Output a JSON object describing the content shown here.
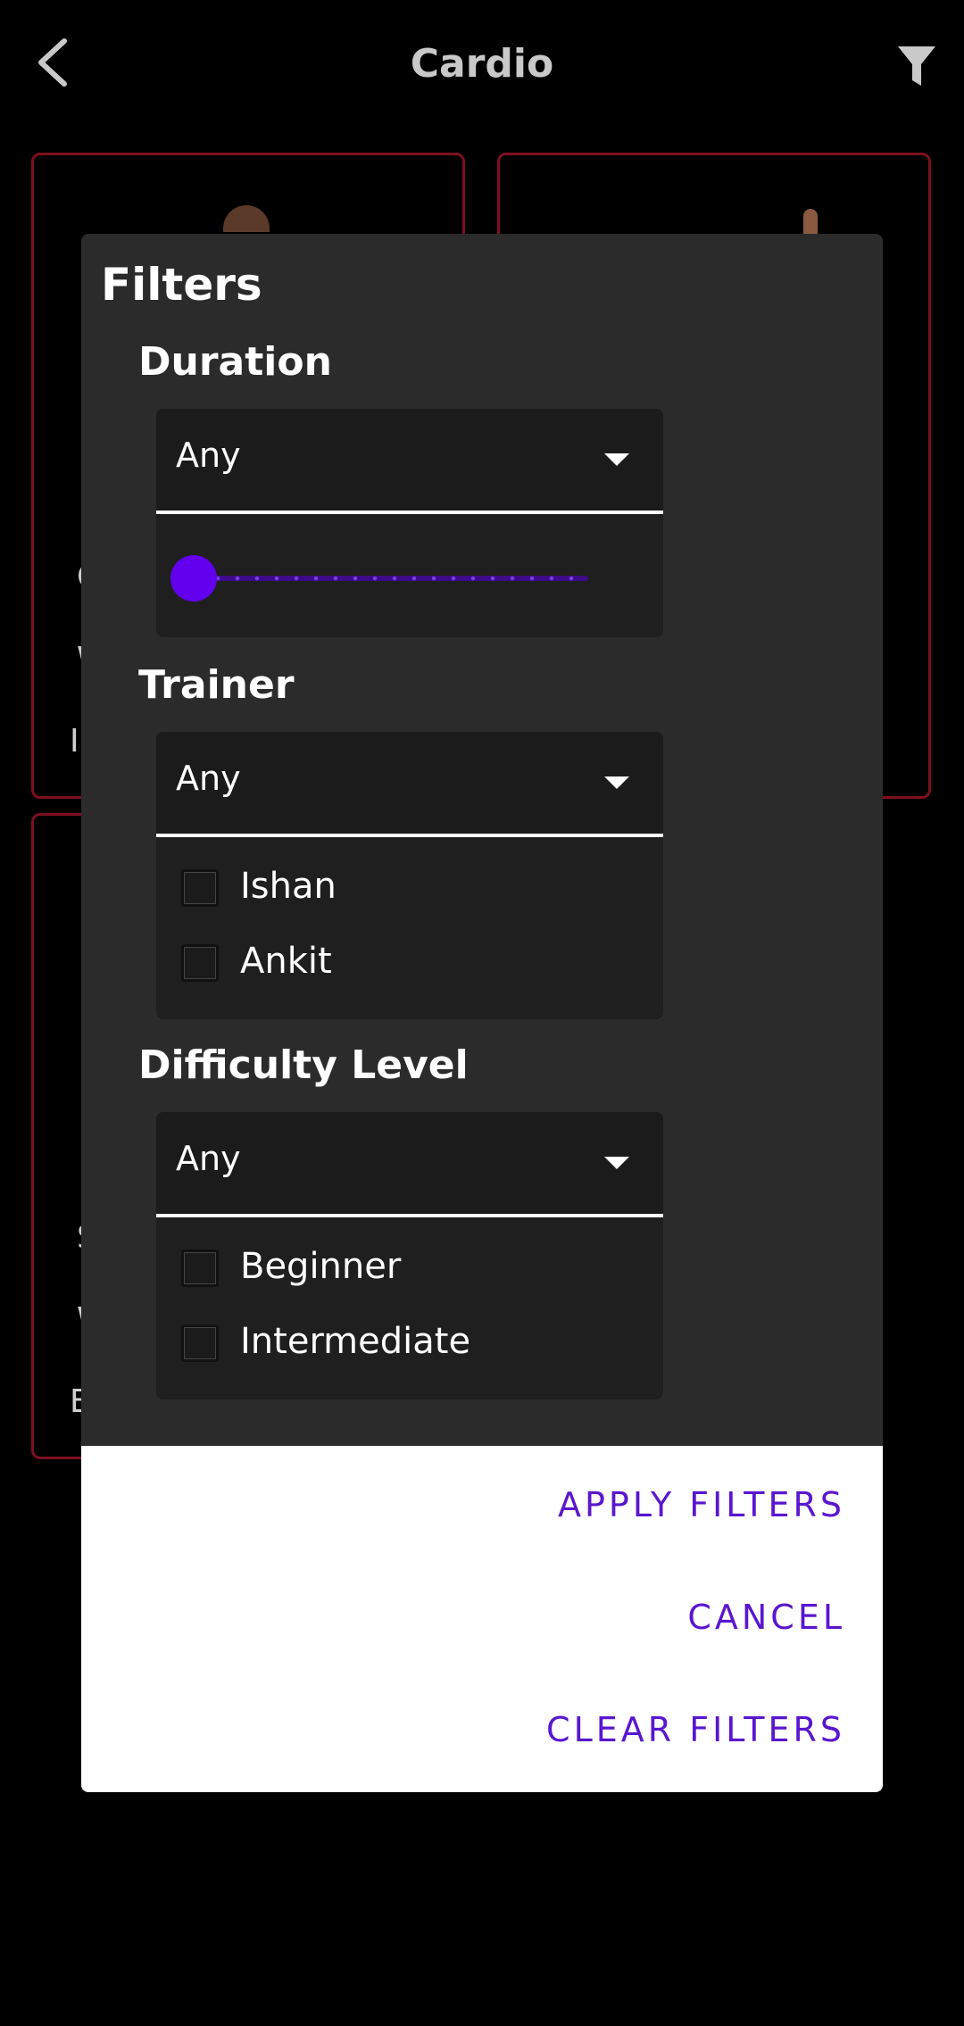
{
  "header": {
    "title": "Cardio",
    "back_icon": "back-arrow-icon",
    "filter_icon": "filter-funnel-icon"
  },
  "background_cards": {
    "fragments": [
      "C",
      "W",
      "I",
      "S",
      "W",
      "E"
    ]
  },
  "dialog": {
    "title": "Filters",
    "duration": {
      "label": "Duration",
      "selected": "Any",
      "slider_level": 0
    },
    "trainer": {
      "label": "Trainer",
      "selected": "Any",
      "options": [
        "Ishan",
        "Ankit"
      ]
    },
    "difficulty": {
      "label": "Difficulty Level",
      "selected": "Any",
      "options": [
        "Beginner",
        "Intermediate"
      ]
    },
    "actions": {
      "apply": "APPLY FILTERS",
      "cancel": "CANCEL",
      "clear": "CLEAR FILTERS"
    }
  },
  "colors": {
    "accent": "#6200EE",
    "action_text": "#5A16CF",
    "card_border": "#7D0F1F",
    "dialog_bg": "#2B2B2B"
  }
}
